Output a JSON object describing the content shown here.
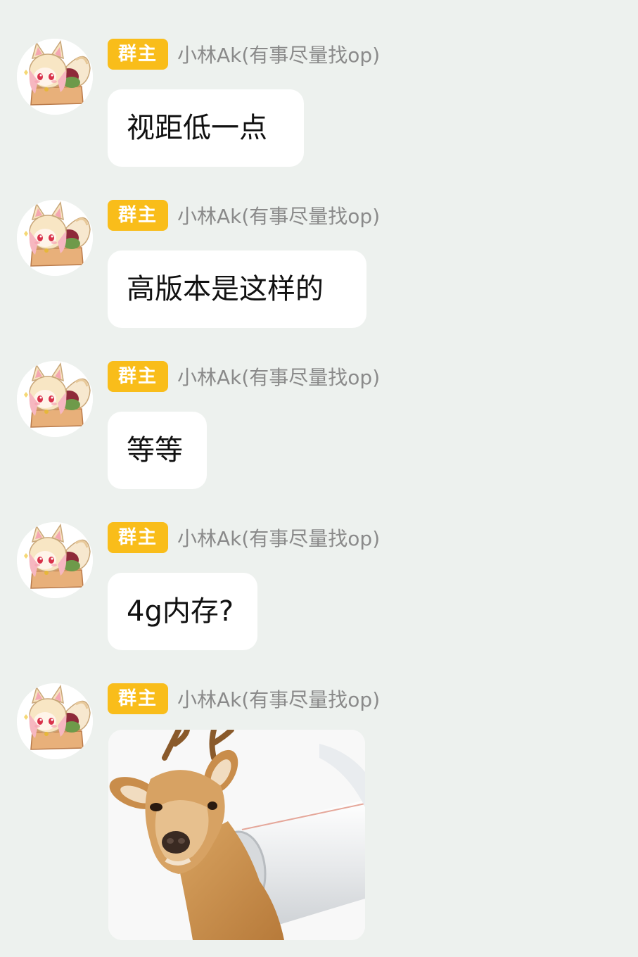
{
  "chat": {
    "messages": [
      {
        "badge": "群主",
        "sender": "小林Ak(有事尽量找op)",
        "text": "视距低一点",
        "avatar_icon": "fox-girl-in-box-avatar"
      },
      {
        "badge": "群主",
        "sender": "小林Ak(有事尽量找op)",
        "text": "高版本是这样的",
        "avatar_icon": "fox-girl-in-box-avatar"
      },
      {
        "badge": "群主",
        "sender": "小林Ak(有事尽量找op)",
        "text": "等等",
        "avatar_icon": "fox-girl-in-box-avatar"
      },
      {
        "badge": "群主",
        "sender": "小林Ak(有事尽量找op)",
        "text": "4g内存?",
        "avatar_icon": "fox-girl-in-box-avatar"
      },
      {
        "badge": "群主",
        "sender": "小林Ak(有事尽量找op)",
        "image": "deer-through-pipe-sticker",
        "avatar_icon": "fox-girl-in-box-avatar"
      }
    ]
  },
  "colors": {
    "background": "#edf1ee",
    "badge": "#f9bd1a",
    "bubble": "#ffffff",
    "sender_text": "#8a8a8a"
  }
}
